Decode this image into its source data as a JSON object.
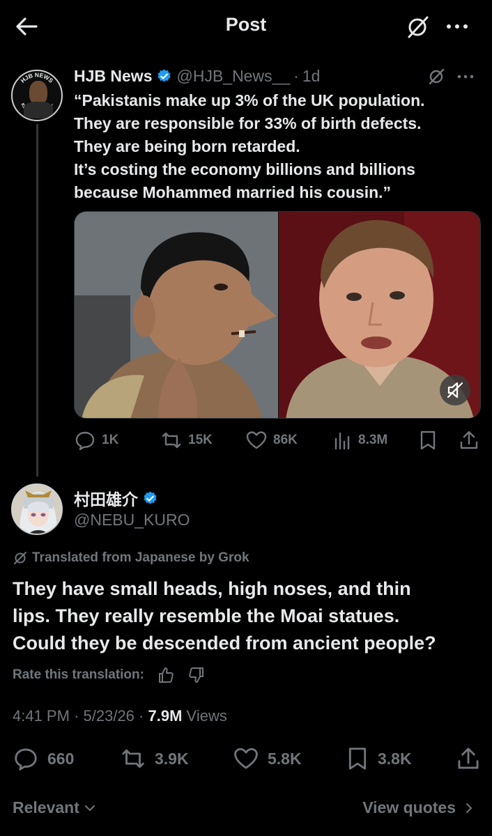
{
  "header": {
    "title": "Post"
  },
  "colors": {
    "accent": "#1d9bf0",
    "muted": "#71767b",
    "text": "#e7e9ea"
  },
  "quoted_post": {
    "author_name": "HJB News",
    "handle": "@HJB_News__",
    "separator": "·",
    "time": "1d",
    "avatar_text_top": "HJB NEWS",
    "avatar_text_bottom": "KEEPING IT REAL",
    "text_lines": [
      "“Pakistanis make up 3% of the UK population.",
      "They are responsible for 33% of birth defects.",
      "They are being born retarded.",
      "It’s costing the economy billions and billions",
      "because Mohammed married his cousin.”"
    ],
    "media_audio": "muted",
    "stats": {
      "replies": "1K",
      "reposts": "15K",
      "likes": "86K",
      "views": "8.3M"
    }
  },
  "main_post": {
    "author_name": "村田雄介",
    "handle": "@NEBU_KURO",
    "translation_note": "Translated from Japanese by Grok",
    "text_lines": [
      "They have small heads, high noses, and thin",
      "lips. They really resemble the Moai statues.",
      "Could they be descended from ancient people?"
    ],
    "rate_label": "Rate this translation:",
    "time": "4:41 PM",
    "date": "5/23/26",
    "meta_sep": "·",
    "views_count": "7.9M",
    "views_label": "Views",
    "stats": {
      "replies": "660",
      "reposts": "3.9K",
      "likes": "5.8K",
      "bookmarks": "3.8K"
    }
  },
  "footer": {
    "sort_label": "Relevant",
    "quotes_link": "View quotes"
  },
  "icons": [
    "back-arrow-icon",
    "grok-icon",
    "more-icon",
    "verified-icon",
    "reply-icon",
    "repost-icon",
    "like-icon",
    "views-icon",
    "bookmark-icon",
    "share-icon",
    "mute-icon",
    "thumbs-up-icon",
    "thumbs-down-icon",
    "chevron-down-icon",
    "chevron-right-icon"
  ]
}
